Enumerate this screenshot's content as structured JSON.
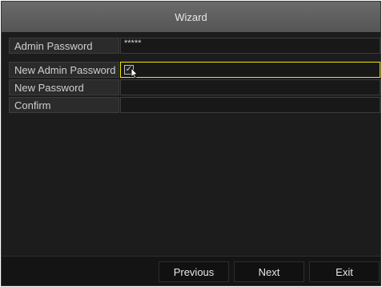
{
  "window": {
    "title": "Wizard"
  },
  "form": {
    "admin_password": {
      "label": "Admin Password",
      "value": "*****"
    },
    "new_admin_password": {
      "label": "New Admin Password",
      "checked": true,
      "check_glyph": "✓"
    },
    "new_password": {
      "label": "New Password",
      "value": ""
    },
    "confirm": {
      "label": "Confirm",
      "value": ""
    }
  },
  "buttons": {
    "previous": "Previous",
    "next": "Next",
    "exit": "Exit"
  },
  "colors": {
    "highlight": "#f0e400",
    "titlebar": "#5f5f5f",
    "background": "#1c1c1c"
  }
}
